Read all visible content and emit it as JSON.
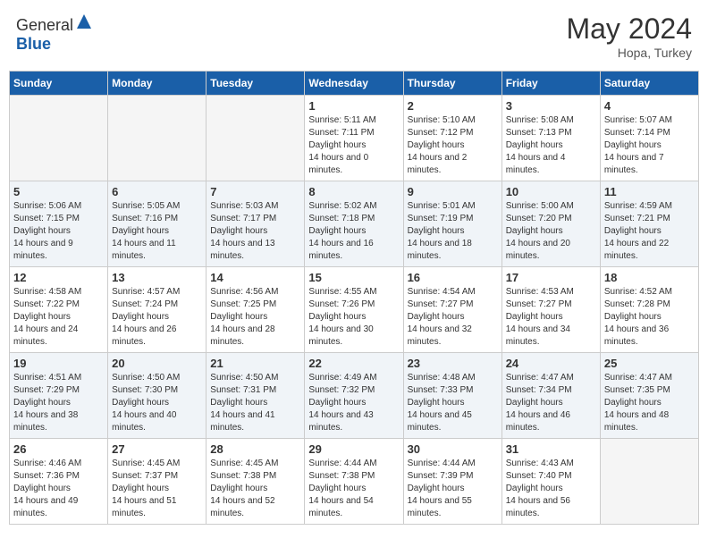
{
  "header": {
    "logo_general": "General",
    "logo_blue": "Blue",
    "month_year": "May 2024",
    "location": "Hopa, Turkey"
  },
  "days_of_week": [
    "Sunday",
    "Monday",
    "Tuesday",
    "Wednesday",
    "Thursday",
    "Friday",
    "Saturday"
  ],
  "weeks": [
    [
      {
        "day": "",
        "empty": true
      },
      {
        "day": "",
        "empty": true
      },
      {
        "day": "",
        "empty": true
      },
      {
        "day": "1",
        "sunrise": "5:11 AM",
        "sunset": "7:11 PM",
        "daylight": "14 hours and 0 minutes."
      },
      {
        "day": "2",
        "sunrise": "5:10 AM",
        "sunset": "7:12 PM",
        "daylight": "14 hours and 2 minutes."
      },
      {
        "day": "3",
        "sunrise": "5:08 AM",
        "sunset": "7:13 PM",
        "daylight": "14 hours and 4 minutes."
      },
      {
        "day": "4",
        "sunrise": "5:07 AM",
        "sunset": "7:14 PM",
        "daylight": "14 hours and 7 minutes."
      }
    ],
    [
      {
        "day": "5",
        "sunrise": "5:06 AM",
        "sunset": "7:15 PM",
        "daylight": "14 hours and 9 minutes."
      },
      {
        "day": "6",
        "sunrise": "5:05 AM",
        "sunset": "7:16 PM",
        "daylight": "14 hours and 11 minutes."
      },
      {
        "day": "7",
        "sunrise": "5:03 AM",
        "sunset": "7:17 PM",
        "daylight": "14 hours and 13 minutes."
      },
      {
        "day": "8",
        "sunrise": "5:02 AM",
        "sunset": "7:18 PM",
        "daylight": "14 hours and 16 minutes."
      },
      {
        "day": "9",
        "sunrise": "5:01 AM",
        "sunset": "7:19 PM",
        "daylight": "14 hours and 18 minutes."
      },
      {
        "day": "10",
        "sunrise": "5:00 AM",
        "sunset": "7:20 PM",
        "daylight": "14 hours and 20 minutes."
      },
      {
        "day": "11",
        "sunrise": "4:59 AM",
        "sunset": "7:21 PM",
        "daylight": "14 hours and 22 minutes."
      }
    ],
    [
      {
        "day": "12",
        "sunrise": "4:58 AM",
        "sunset": "7:22 PM",
        "daylight": "14 hours and 24 minutes."
      },
      {
        "day": "13",
        "sunrise": "4:57 AM",
        "sunset": "7:24 PM",
        "daylight": "14 hours and 26 minutes."
      },
      {
        "day": "14",
        "sunrise": "4:56 AM",
        "sunset": "7:25 PM",
        "daylight": "14 hours and 28 minutes."
      },
      {
        "day": "15",
        "sunrise": "4:55 AM",
        "sunset": "7:26 PM",
        "daylight": "14 hours and 30 minutes."
      },
      {
        "day": "16",
        "sunrise": "4:54 AM",
        "sunset": "7:27 PM",
        "daylight": "14 hours and 32 minutes."
      },
      {
        "day": "17",
        "sunrise": "4:53 AM",
        "sunset": "7:27 PM",
        "daylight": "14 hours and 34 minutes."
      },
      {
        "day": "18",
        "sunrise": "4:52 AM",
        "sunset": "7:28 PM",
        "daylight": "14 hours and 36 minutes."
      }
    ],
    [
      {
        "day": "19",
        "sunrise": "4:51 AM",
        "sunset": "7:29 PM",
        "daylight": "14 hours and 38 minutes."
      },
      {
        "day": "20",
        "sunrise": "4:50 AM",
        "sunset": "7:30 PM",
        "daylight": "14 hours and 40 minutes."
      },
      {
        "day": "21",
        "sunrise": "4:50 AM",
        "sunset": "7:31 PM",
        "daylight": "14 hours and 41 minutes."
      },
      {
        "day": "22",
        "sunrise": "4:49 AM",
        "sunset": "7:32 PM",
        "daylight": "14 hours and 43 minutes."
      },
      {
        "day": "23",
        "sunrise": "4:48 AM",
        "sunset": "7:33 PM",
        "daylight": "14 hours and 45 minutes."
      },
      {
        "day": "24",
        "sunrise": "4:47 AM",
        "sunset": "7:34 PM",
        "daylight": "14 hours and 46 minutes."
      },
      {
        "day": "25",
        "sunrise": "4:47 AM",
        "sunset": "7:35 PM",
        "daylight": "14 hours and 48 minutes."
      }
    ],
    [
      {
        "day": "26",
        "sunrise": "4:46 AM",
        "sunset": "7:36 PM",
        "daylight": "14 hours and 49 minutes."
      },
      {
        "day": "27",
        "sunrise": "4:45 AM",
        "sunset": "7:37 PM",
        "daylight": "14 hours and 51 minutes."
      },
      {
        "day": "28",
        "sunrise": "4:45 AM",
        "sunset": "7:38 PM",
        "daylight": "14 hours and 52 minutes."
      },
      {
        "day": "29",
        "sunrise": "4:44 AM",
        "sunset": "7:38 PM",
        "daylight": "14 hours and 54 minutes."
      },
      {
        "day": "30",
        "sunrise": "4:44 AM",
        "sunset": "7:39 PM",
        "daylight": "14 hours and 55 minutes."
      },
      {
        "day": "31",
        "sunrise": "4:43 AM",
        "sunset": "7:40 PM",
        "daylight": "14 hours and 56 minutes."
      },
      {
        "day": "",
        "empty": true
      }
    ]
  ],
  "colors": {
    "header_blue": "#1a5fa8",
    "logo_blue": "#1a5fa8"
  }
}
